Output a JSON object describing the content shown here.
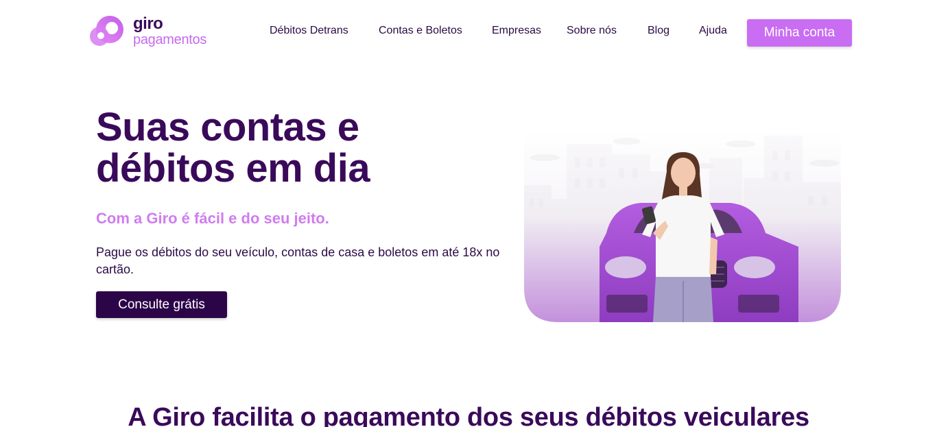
{
  "header": {
    "logo": {
      "line1": "giro",
      "line2": "pagamentos"
    },
    "nav": [
      {
        "label": "Débitos Detrans"
      },
      {
        "label": "Contas e Boletos"
      },
      {
        "label": "Empresas"
      },
      {
        "label": "Sobre nós"
      },
      {
        "label": "Blog"
      },
      {
        "label": "Ajuda"
      }
    ],
    "account_button": "Minha conta"
  },
  "hero": {
    "title": "Suas contas e débitos em dia",
    "subtitle": "Com a Giro é fácil e do seu jeito.",
    "description": "Pague os débitos do seu veículo, contas de casa e boletos em até 18x no cartão.",
    "cta": "Consulte grátis"
  },
  "section": {
    "title": "A Giro facilita o pagamento dos seus débitos veiculares"
  },
  "colors": {
    "brand_dark": "#3a0a5a",
    "brand_light": "#c96df2",
    "cta_background": "#2c0548"
  }
}
